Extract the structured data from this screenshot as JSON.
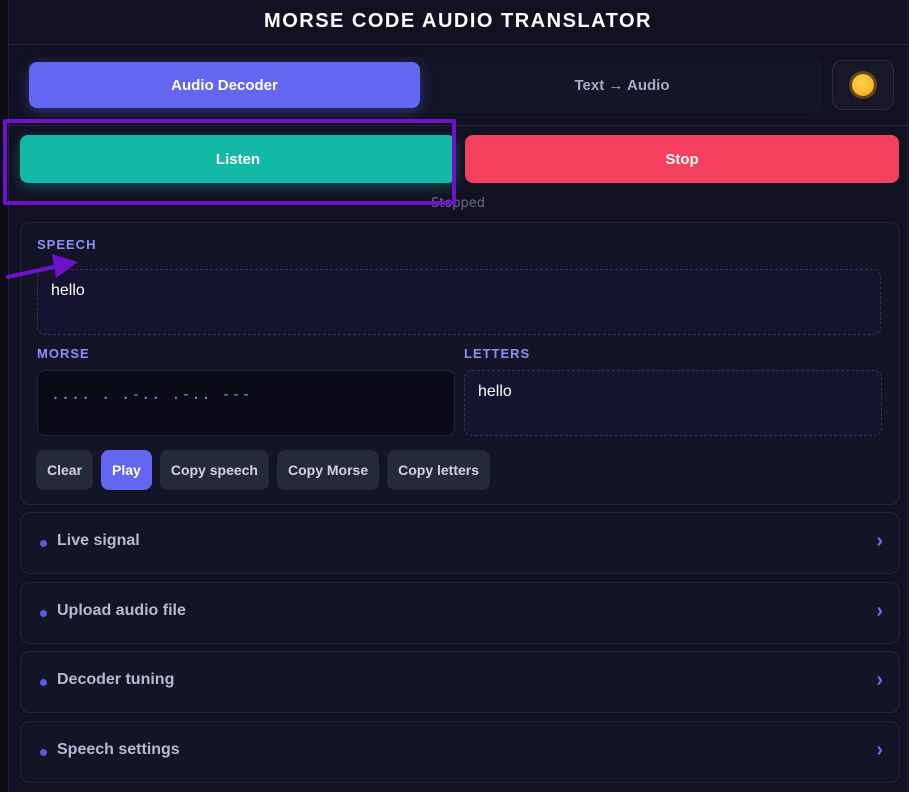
{
  "app": {
    "title": "MORSE CODE AUDIO TRANSLATOR"
  },
  "tabs": [
    {
      "label": "Audio Decoder",
      "active": true
    },
    {
      "label": "Text → Audio",
      "active": false
    }
  ],
  "theme_toggle": {
    "icon": "sun-icon"
  },
  "controls": {
    "listen_label": "Listen",
    "stop_label": "Stop",
    "status": "Stopped"
  },
  "speech": {
    "label": "SPEECH",
    "value": "hello"
  },
  "morse": {
    "label": "MORSE",
    "value": ".... . .-.. .-.. ---"
  },
  "letters": {
    "label": "LETTERS",
    "value": "hello"
  },
  "actions": {
    "clear": "Clear",
    "play": "Play",
    "copy_speech": "Copy speech",
    "copy_morse": "Copy Morse",
    "copy_letters": "Copy letters"
  },
  "sections": [
    {
      "label": "Live signal"
    },
    {
      "label": "Upload audio file"
    },
    {
      "label": "Decoder tuning"
    },
    {
      "label": "Speech settings"
    }
  ],
  "colors": {
    "accent": "#6366f1",
    "listen": "#14b8a6",
    "stop": "#f43f5e",
    "annotation": "#6d12c9"
  }
}
